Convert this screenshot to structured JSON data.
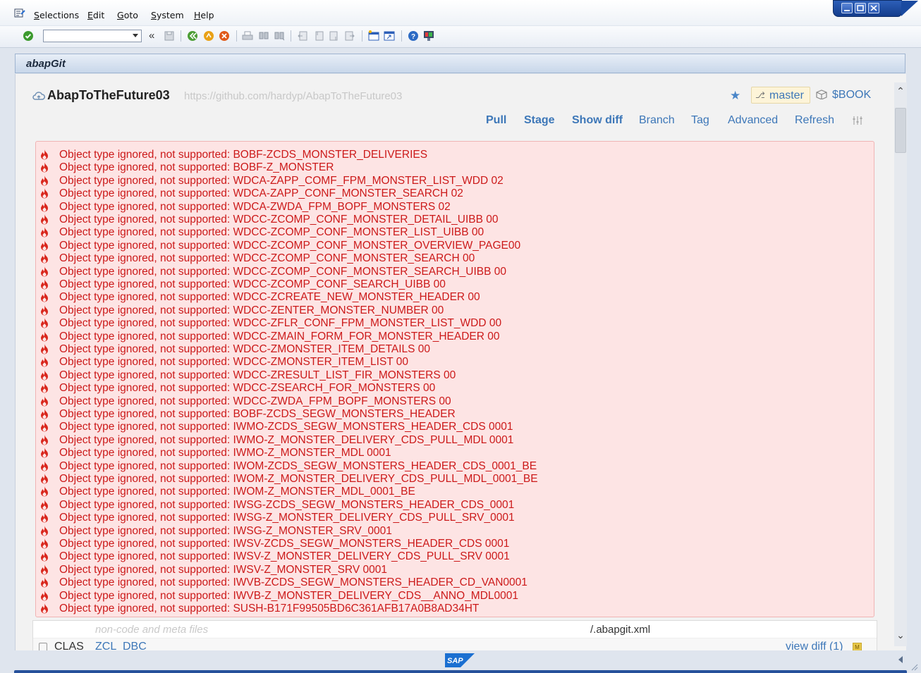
{
  "menu": {
    "items": [
      {
        "label": "Selections",
        "mnemonic": "S",
        "rest": "elections"
      },
      {
        "label": "Edit",
        "mnemonic": "E",
        "rest": "dit"
      },
      {
        "label": "Goto",
        "mnemonic": "G",
        "rest": "oto"
      },
      {
        "label": "System",
        "mnemonic": "S",
        "rest": "ystem"
      },
      {
        "label": "Help",
        "mnemonic": "H",
        "rest": "elp"
      }
    ]
  },
  "toolbar": {
    "command_field_value": "",
    "back_glyph": "«"
  },
  "title": "abapGit",
  "repo": {
    "name": "AbapToTheFuture03",
    "url": "https://github.com/hardyp/AbapToTheFuture03",
    "branch": "master",
    "package": "$BOOK",
    "actions": [
      {
        "label": "Pull",
        "bold": true
      },
      {
        "label": "Stage",
        "bold": true
      },
      {
        "label": "Show diff",
        "bold": true
      },
      {
        "label": "Branch",
        "bold": false
      },
      {
        "label": "Tag",
        "bold": false
      },
      {
        "label": "Advanced",
        "bold": false
      },
      {
        "label": "Refresh",
        "bold": false
      }
    ]
  },
  "errors": {
    "prefix": "Object type ignored, not supported: ",
    "objects": [
      "BOBF-ZCDS_MONSTER_DELIVERIES",
      "BOBF-Z_MONSTER",
      "WDCA-ZAPP_COMF_FPM_MONSTER_LIST_WDD 02",
      "WDCA-ZAPP_CONF_MONSTER_SEARCH 02",
      "WDCA-ZWDA_FPM_BOPF_MONSTERS 02",
      "WDCC-ZCOMP_CONF_MONSTER_DETAIL_UIBB 00",
      "WDCC-ZCOMP_CONF_MONSTER_LIST_UIBB 00",
      "WDCC-ZCOMP_CONF_MONSTER_OVERVIEW_PAGE00",
      "WDCC-ZCOMP_CONF_MONSTER_SEARCH 00",
      "WDCC-ZCOMP_CONF_MONSTER_SEARCH_UIBB 00",
      "WDCC-ZCOMP_CONF_SEARCH_UIBB 00",
      "WDCC-ZCREATE_NEW_MONSTER_HEADER 00",
      "WDCC-ZENTER_MONSTER_NUMBER 00",
      "WDCC-ZFLR_CONF_FPM_MONSTER_LIST_WDD 00",
      "WDCC-ZMAIN_FORM_FOR_MONSTER_HEADER 00",
      "WDCC-ZMONSTER_ITEM_DETAILS 00",
      "WDCC-ZMONSTER_ITEM_LIST 00",
      "WDCC-ZRESULT_LIST_FIR_MONSTERS 00",
      "WDCC-ZSEARCH_FOR_MONSTERS 00",
      "WDCC-ZWDA_FPM_BOPF_MONSTERS 00",
      "BOBF-ZCDS_SEGW_MONSTERS_HEADER",
      "IWMO-ZCDS_SEGW_MONSTERS_HEADER_CDS 0001",
      "IWMO-Z_MONSTER_DELIVERY_CDS_PULL_MDL 0001",
      "IWMO-Z_MONSTER_MDL 0001",
      "IWOM-ZCDS_SEGW_MONSTERS_HEADER_CDS_0001_BE",
      "IWOM-Z_MONSTER_DELIVERY_CDS_PULL_MDL_0001_BE",
      "IWOM-Z_MONSTER_MDL_0001_BE",
      "IWSG-ZCDS_SEGW_MONSTERS_HEADER_CDS_0001",
      "IWSG-Z_MONSTER_DELIVERY_CDS_PULL_SRV_0001",
      "IWSG-Z_MONSTER_SRV_0001",
      "IWSV-ZCDS_SEGW_MONSTERS_HEADER_CDS 0001",
      "IWSV-Z_MONSTER_DELIVERY_CDS_PULL_SRV 0001",
      "IWSV-Z_MONSTER_SRV 0001",
      "IWVB-ZCDS_SEGW_MONSTERS_HEADER_CD_VAN0001",
      "IWVB-Z_MONSTER_DELIVERY_CDS__ANNO_MDL0001",
      "SUSH-B171F99505BD6C361AFB17A0B8AD34HT"
    ]
  },
  "files": {
    "meta_label": "non-code and meta files",
    "meta_file": "/.abapgit.xml",
    "row": {
      "type": "CLAS",
      "name": "ZCL",
      "package": "DBC",
      "diff_label": "view diff (1)",
      "badge": "M"
    }
  },
  "footer": {
    "logo_text": "SAP"
  },
  "colors": {
    "error_text": "#cc1a1a",
    "error_bg": "#fde4e4",
    "link": "#3d77b8",
    "branch_bg": "#fdf4d8"
  },
  "icons": [
    "app-menu-icon",
    "enter-check-icon",
    "save-icon",
    "back-icon",
    "exit-icon",
    "cancel-icon",
    "print-icon",
    "find-icon",
    "find-next-icon",
    "first-page-icon",
    "previous-page-icon",
    "next-page-icon",
    "last-page-icon",
    "create-session-icon",
    "generate-shortcut-icon",
    "help-icon",
    "customize-layout-icon",
    "cloud-repo-icon",
    "star-icon",
    "git-branch-icon",
    "package-icon",
    "settings-icon",
    "fire-icon"
  ]
}
